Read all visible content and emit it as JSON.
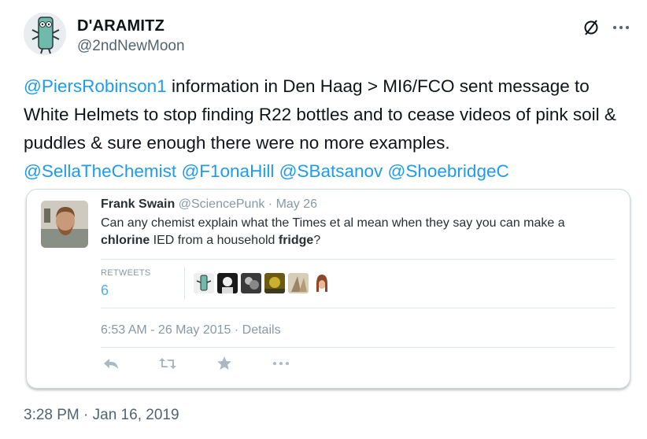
{
  "tweet": {
    "author": {
      "name": "D'ARAMITZ",
      "handle": "@2ndNewMoon",
      "avatar_icon": "cartoon-character-avatar"
    },
    "text": {
      "mention1": "@PiersRobinson1",
      "part1": " information  in Den Haag > MI6/FCO sent message to White Helmets to stop finding R22 bottles and to cease videos of pink soil & puddles & sure enough there were no more examples.",
      "mention2": "@SellaTheChemist",
      "mention3": "@F1onaHill",
      "mention4": "@SBatsanov",
      "mention5": "@ShoebridgeC"
    },
    "timestamp": "3:28 PM · Jan 16, 2019",
    "icons": {
      "unfollow": "circle-slash-icon",
      "more": "ellipsis-icon"
    }
  },
  "quote": {
    "name": "Frank Swain",
    "handle": "@SciencePunk",
    "dot": " · ",
    "date": "May 26",
    "text": {
      "t1": "Can any chemist explain what the Times et al mean when they say you can make a ",
      "b1": "chlorine",
      "t2": " IED from a household ",
      "b2": "fridge",
      "t3": "?"
    },
    "retweets_label": "RETWEETS",
    "retweets_count": "6",
    "time": "6:53 AM - 26 May 2015",
    "details_sep": " · ",
    "details": "Details",
    "actions": [
      "reply-icon",
      "retweet-icon",
      "favorite-icon",
      "more-icon"
    ]
  },
  "colors": {
    "link": "#1d9bf0",
    "muted": "#536471",
    "legacy_blue": "#55acee"
  }
}
